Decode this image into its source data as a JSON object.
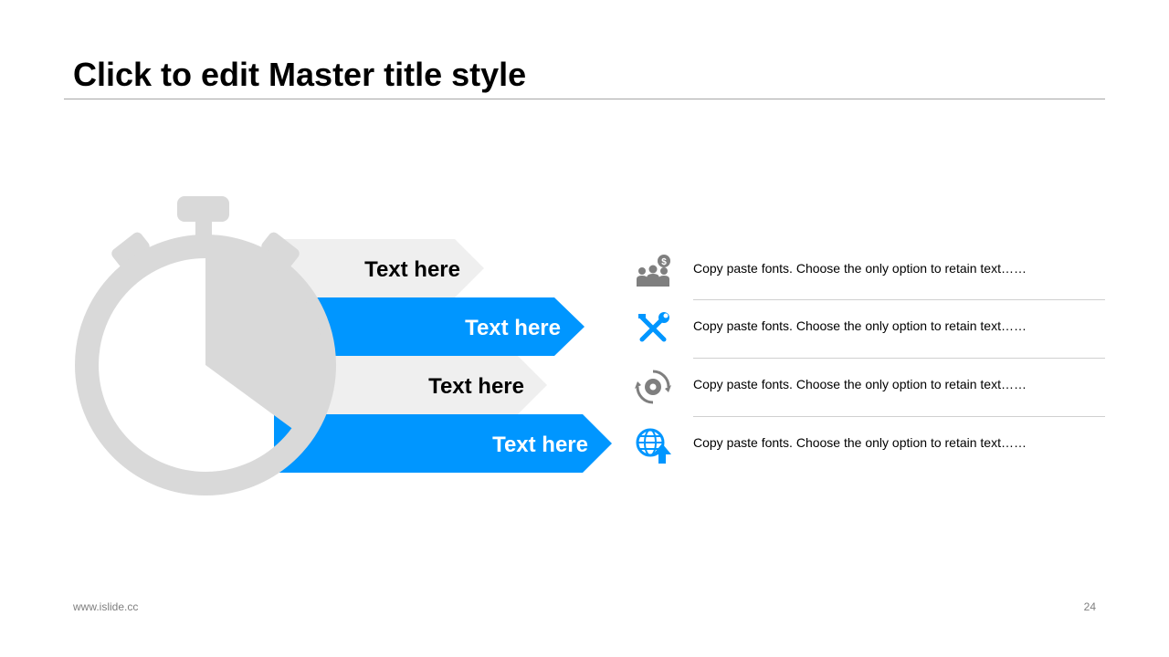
{
  "slide": {
    "title": "Click to edit Master title style",
    "footer_url": "www.islide.cc",
    "page_number": "24"
  },
  "colors": {
    "accent": "#0096ff",
    "gray_shape": "#d9d9d9",
    "light_arrow": "#efefef",
    "icon_gray": "#7f7f7f"
  },
  "arrows": [
    {
      "label": "Text here",
      "style": "light"
    },
    {
      "label": "Text here",
      "style": "accent"
    },
    {
      "label": "Text here",
      "style": "light"
    },
    {
      "label": "Text here",
      "style": "accent"
    }
  ],
  "items": [
    {
      "icon": "people-money-icon",
      "text": "Copy paste fonts. Choose the only option to retain text……"
    },
    {
      "icon": "tools-icon",
      "text": "Copy paste fonts. Choose the only option to retain text……"
    },
    {
      "icon": "gear-cycle-icon",
      "text": "Copy paste fonts. Choose the only option to retain text……"
    },
    {
      "icon": "globe-upload-icon",
      "text": "Copy paste fonts. Choose the only option to retain text……"
    }
  ]
}
